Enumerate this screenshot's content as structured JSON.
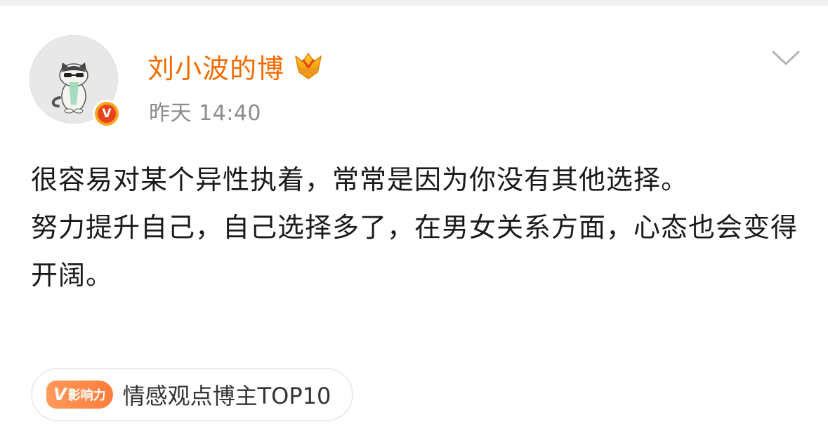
{
  "post": {
    "author": {
      "name": "刘小波的博",
      "verified_mark": "V"
    },
    "timestamp": "昨天 14:40",
    "content": {
      "paragraphs": [
        "很容易对某个异性执着，常常是因为你没有其他选择。",
        "努力提升自己，自己选择多了，在男女关系方面，心态也会变得开阔。"
      ]
    },
    "tag": {
      "badge_mark": "V",
      "badge_label": "影响力",
      "label": "情感观点博主TOP10"
    }
  },
  "icons": {
    "more": "chevron-down-icon",
    "vip": "vip-crown-icon",
    "verified": "verified-v-icon"
  },
  "colors": {
    "username": "#f36b00",
    "timestamp": "#8c8c8c",
    "text": "#1a1a1a",
    "badge_orange": "#ff7d3c"
  }
}
